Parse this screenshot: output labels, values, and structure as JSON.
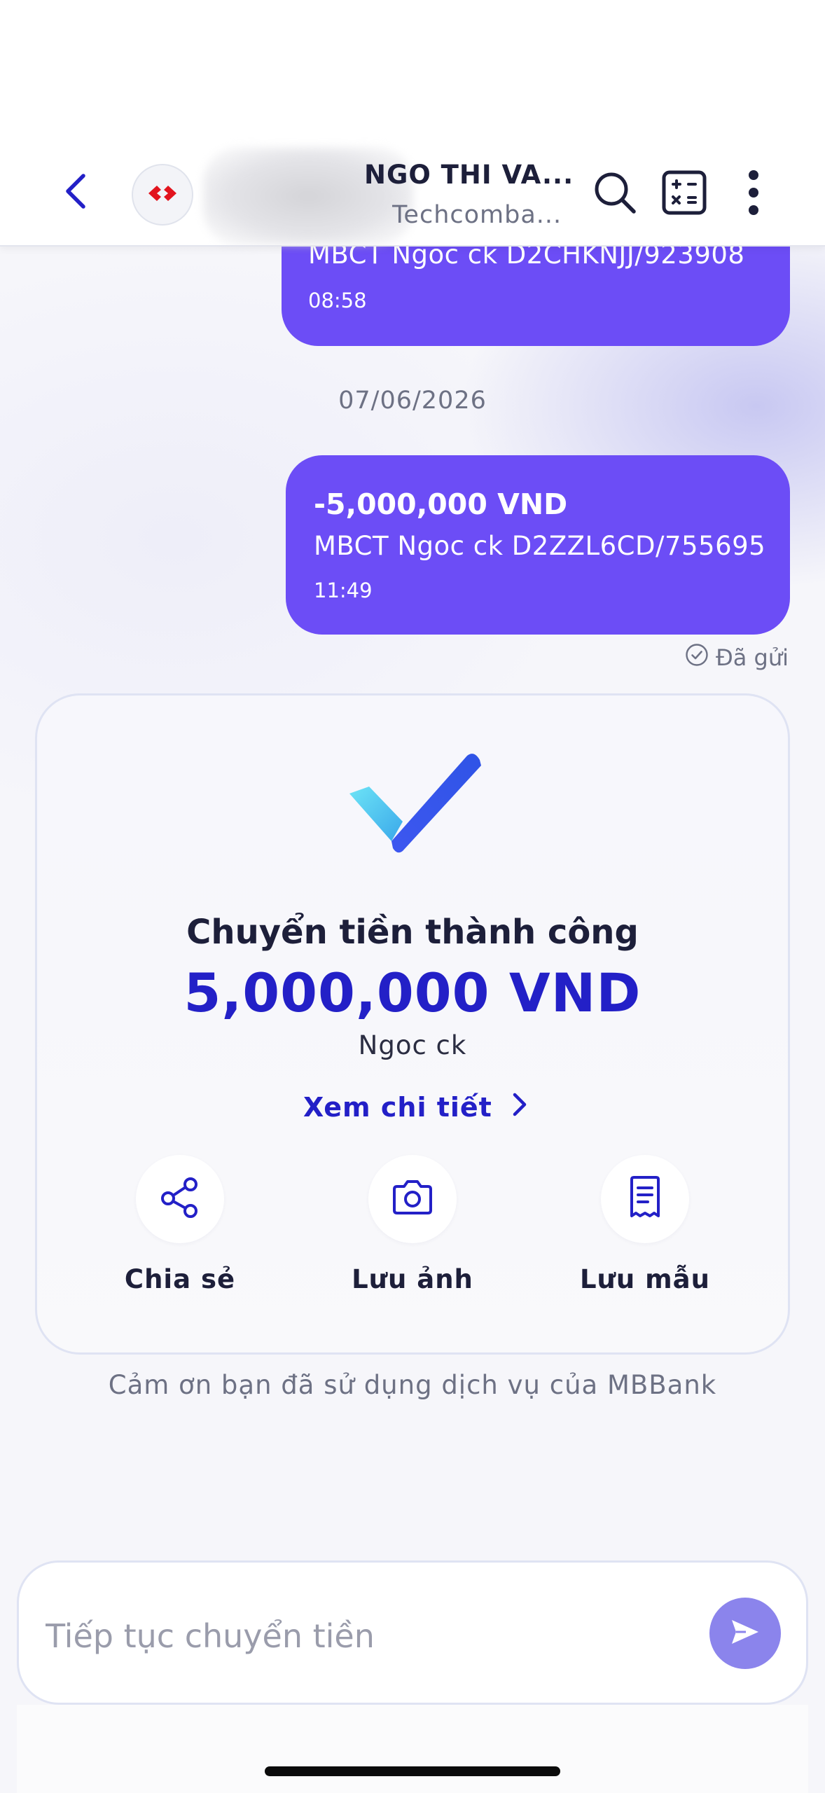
{
  "header": {
    "contact_name": "NGO THI VA...",
    "contact_bank": "Techcomba...",
    "icons": {
      "back": "chevron-left-icon",
      "bank_logo": "techcombank-logo",
      "search": "search-icon",
      "calculator": "calculator-icon",
      "more": "more-vertical-icon"
    }
  },
  "messages": [
    {
      "description": "MBCT Ngoc ck D2CHKNJJ/923908",
      "time": "08:58"
    },
    {
      "amount": "-5,000,000 VND",
      "description": "MBCT Ngoc ck D2ZZL6CD/755695",
      "time": "11:49"
    }
  ],
  "date_separator": "07/06/2026",
  "sent_status": "Đã gửi",
  "result": {
    "title": "Chuyển tiền thành công",
    "amount": "5,000,000 VND",
    "note": "Ngoc ck",
    "detail_link": "Xem chi tiết",
    "actions": [
      {
        "label": "Chia sẻ",
        "icon": "share-icon"
      },
      {
        "label": "Lưu ảnh",
        "icon": "camera-icon"
      },
      {
        "label": "Lưu mẫu",
        "icon": "receipt-icon"
      }
    ]
  },
  "thanks_text": "Cảm ơn bạn đã sử dụng dịch vụ của MBBank",
  "input": {
    "placeholder": "Tiếp tục chuyển tiền",
    "value": ""
  },
  "colors": {
    "bubble": "#6c4df6",
    "accent": "#2320c7",
    "send_button": "#8b84ec"
  }
}
